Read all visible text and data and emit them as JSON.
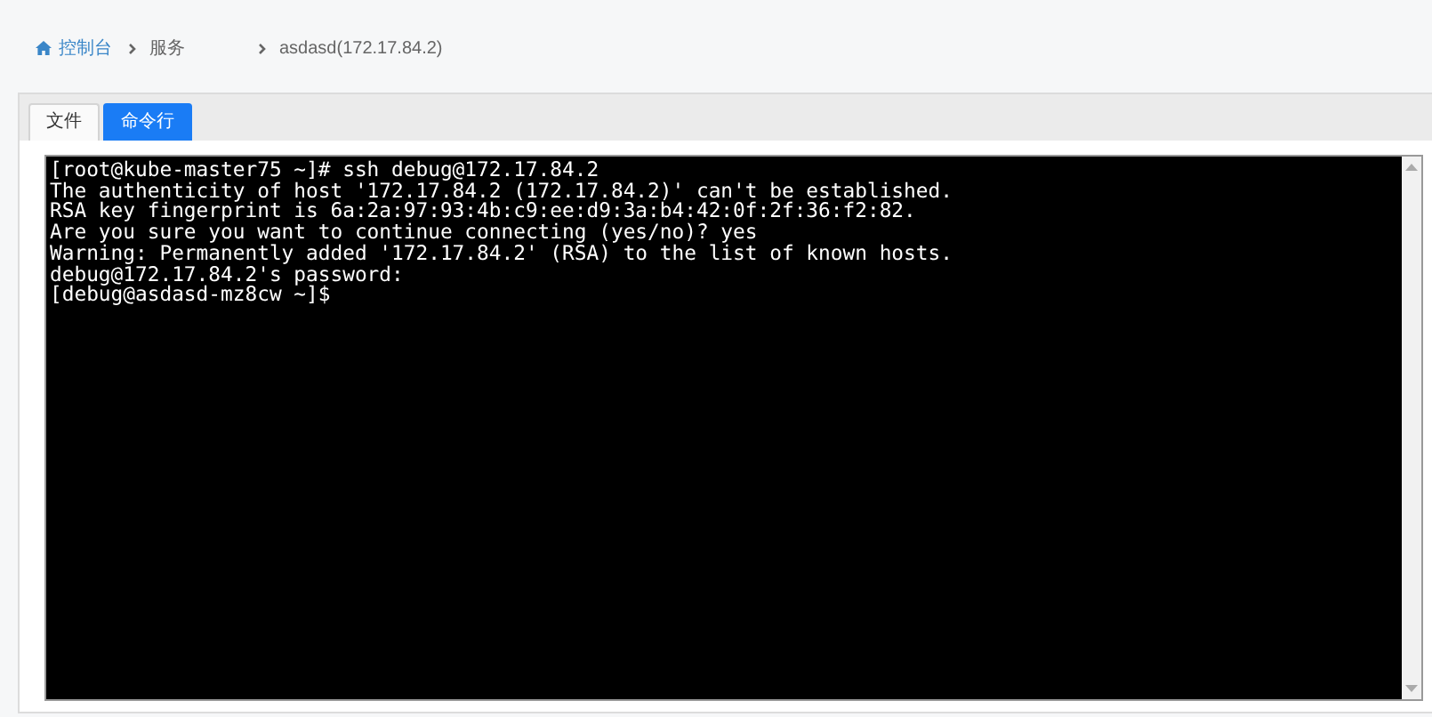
{
  "breadcrumb": [
    {
      "label": "控制台",
      "link": true
    },
    {
      "label": "服务",
      "link": false
    },
    {
      "label": "asdasd(172.17.84.2)",
      "link": false
    }
  ],
  "tabs": [
    {
      "label": "文件",
      "selected": false
    },
    {
      "label": "命令行",
      "selected": true
    }
  ],
  "terminal": {
    "lines": [
      "[root@kube-master75 ~]# ssh debug@172.17.84.2",
      "The authenticity of host '172.17.84.2 (172.17.84.2)' can't be established.",
      "RSA key fingerprint is 6a:2a:97:93:4b:c9:ee:d9:3a:b4:42:0f:2f:36:f2:82.",
      "Are you sure you want to continue connecting (yes/no)? yes",
      "Warning: Permanently added '172.17.84.2' (RSA) to the list of known hosts.",
      "debug@172.17.84.2's password:",
      "[debug@asdasd-mz8cw ~]$"
    ]
  }
}
